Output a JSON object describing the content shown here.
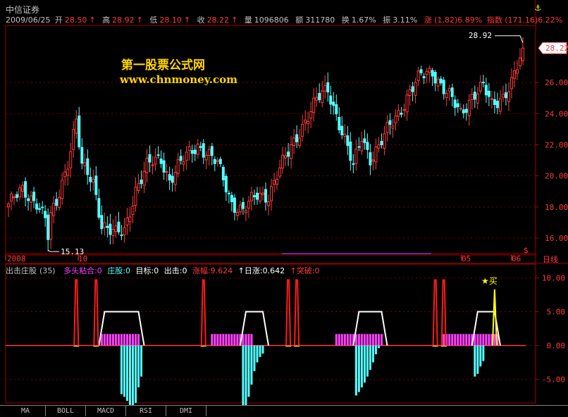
{
  "header": {
    "title": "中信证券",
    "anchor_icon": "anchor-icon"
  },
  "quote": {
    "date": "2009/06/25",
    "open_label": "开",
    "open": "28.50",
    "high_label": "高",
    "high": "28.92",
    "low_label": "低",
    "low": "28.10",
    "close_label": "收",
    "close": "28.22",
    "volume_label": "量",
    "volume": "1096806",
    "amount_label": "额",
    "amount": "311780",
    "turnover_label": "换",
    "turnover": "1.67%",
    "amplitude_label": "振",
    "amplitude": "3.11%",
    "change": "涨 (1.82)6.89%",
    "index": "指数 (171.16)6.22%"
  },
  "watermark": {
    "line1": "第一股票公式网",
    "line2": "www.chnmoney.com"
  },
  "main_chart": {
    "y_ticks": [
      "26.00",
      "24.00",
      "22.00",
      "20.00",
      "18.00",
      "16.00"
    ],
    "last_price_tag": "28.22",
    "high_note": "28.92",
    "low_note": "15.13",
    "x_labels": [
      "2008",
      "10",
      "05",
      "06"
    ],
    "period_label": "日线",
    "marker": "$",
    "colors": {
      "up": "#ff3a3a",
      "down": "#54ffff",
      "grid": "#a00000"
    }
  },
  "indicator": {
    "name": "出击庄股",
    "param": "(35)",
    "items": [
      {
        "label": "多头粘合:0",
        "color": "#ff40ff"
      },
      {
        "label": "庄股:0",
        "color": "#54ffff"
      },
      {
        "label": "目标:0",
        "color": "#ffffff"
      },
      {
        "label": "出击:0",
        "color": "#ffffff"
      },
      {
        "label": "涨幅:9.624",
        "color": "#ff3a3a"
      },
      {
        "label": "↑日涨:0.642",
        "color": "#ffffff"
      },
      {
        "label": "↑突破:0",
        "color": "#ff3a3a"
      }
    ],
    "y_ticks": [
      "10.00",
      "5.00",
      "0.00",
      "-5.00"
    ],
    "buy_label": "★买"
  },
  "chart_data": {
    "type": "candlestick",
    "main_ylim": [
      15,
      29.5
    ],
    "indicator_ylim": [
      -8.5,
      11
    ],
    "main_notes": {
      "high": 28.92,
      "low": 15.13
    },
    "spikes_red": [
      24,
      31,
      69,
      99,
      102,
      151,
      154
    ],
    "spike_yellow": 172,
    "white_plateaus": [
      [
        34,
        46
      ],
      [
        84,
        90
      ],
      [
        124,
        132
      ],
      [
        166,
        172
      ]
    ],
    "magenta_bars": [
      [
        33,
        46
      ],
      [
        72,
        86
      ],
      [
        116,
        132
      ],
      [
        154,
        173
      ]
    ],
    "cyan_bar_groups": [
      {
        "start": 40,
        "values": [
          -7.2,
          -7.6,
          -8.2,
          -8.8,
          -9.2,
          -8.5,
          -6.2,
          -4.6
        ]
      },
      {
        "start": 83,
        "values": [
          -9.8,
          -9.2,
          -7.6,
          -5.8,
          -3.8,
          -2.5,
          -1.7,
          -1.2
        ]
      },
      {
        "start": 123,
        "values": [
          -7.4,
          -6.9,
          -6.2,
          -5.5,
          -4.6,
          -3.6,
          -2.5,
          -1.3,
          -0.4
        ]
      },
      {
        "start": 165,
        "values": [
          -4.6,
          -4.2,
          -3.1,
          -2.3
        ]
      }
    ]
  },
  "tabs": [
    "MA",
    "BOLL",
    "MACD",
    "RSI",
    "DMI"
  ]
}
